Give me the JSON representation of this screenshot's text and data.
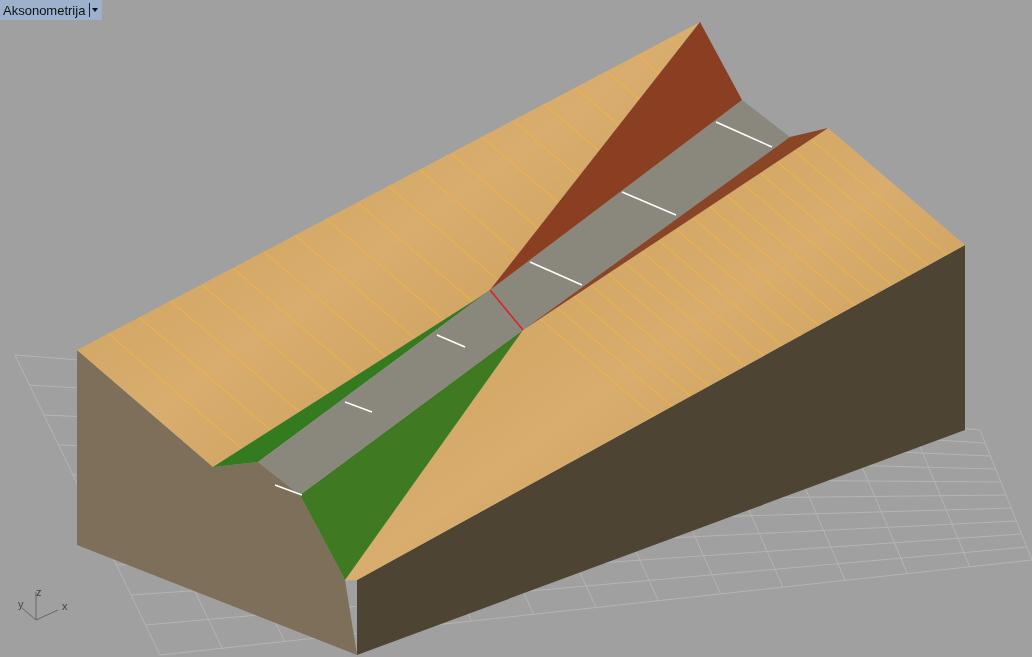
{
  "viewport": {
    "title": "Aksonometrija"
  },
  "axis_labels": [
    {
      "kind": "z",
      "text": "z"
    },
    {
      "kind": "y",
      "text": "y"
    },
    {
      "kind": "x",
      "text": "x"
    }
  ]
}
